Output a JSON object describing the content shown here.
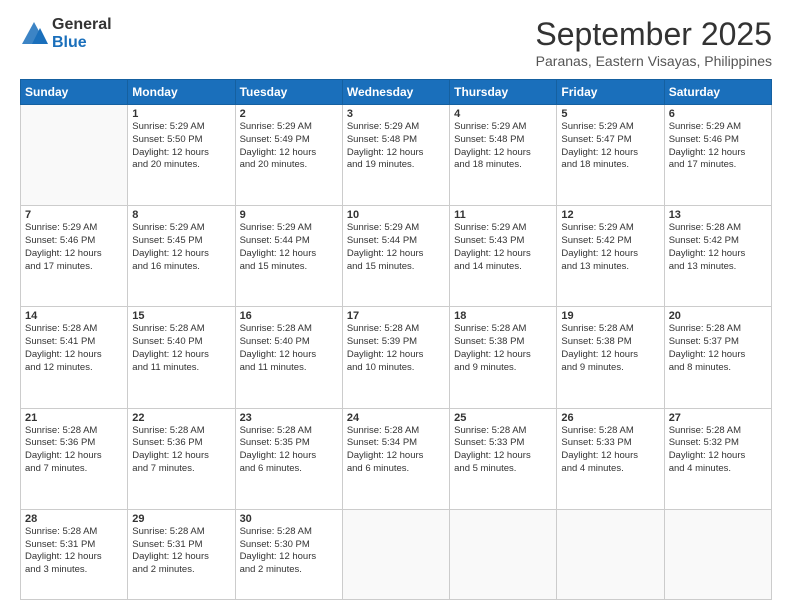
{
  "logo": {
    "general": "General",
    "blue": "Blue"
  },
  "header": {
    "month": "September 2025",
    "location": "Paranas, Eastern Visayas, Philippines"
  },
  "days_of_week": [
    "Sunday",
    "Monday",
    "Tuesday",
    "Wednesday",
    "Thursday",
    "Friday",
    "Saturday"
  ],
  "weeks": [
    [
      {
        "day": "",
        "info": ""
      },
      {
        "day": "1",
        "info": "Sunrise: 5:29 AM\nSunset: 5:50 PM\nDaylight: 12 hours\nand 20 minutes."
      },
      {
        "day": "2",
        "info": "Sunrise: 5:29 AM\nSunset: 5:49 PM\nDaylight: 12 hours\nand 20 minutes."
      },
      {
        "day": "3",
        "info": "Sunrise: 5:29 AM\nSunset: 5:48 PM\nDaylight: 12 hours\nand 19 minutes."
      },
      {
        "day": "4",
        "info": "Sunrise: 5:29 AM\nSunset: 5:48 PM\nDaylight: 12 hours\nand 18 minutes."
      },
      {
        "day": "5",
        "info": "Sunrise: 5:29 AM\nSunset: 5:47 PM\nDaylight: 12 hours\nand 18 minutes."
      },
      {
        "day": "6",
        "info": "Sunrise: 5:29 AM\nSunset: 5:46 PM\nDaylight: 12 hours\nand 17 minutes."
      }
    ],
    [
      {
        "day": "7",
        "info": "Sunrise: 5:29 AM\nSunset: 5:46 PM\nDaylight: 12 hours\nand 17 minutes."
      },
      {
        "day": "8",
        "info": "Sunrise: 5:29 AM\nSunset: 5:45 PM\nDaylight: 12 hours\nand 16 minutes."
      },
      {
        "day": "9",
        "info": "Sunrise: 5:29 AM\nSunset: 5:44 PM\nDaylight: 12 hours\nand 15 minutes."
      },
      {
        "day": "10",
        "info": "Sunrise: 5:29 AM\nSunset: 5:44 PM\nDaylight: 12 hours\nand 15 minutes."
      },
      {
        "day": "11",
        "info": "Sunrise: 5:29 AM\nSunset: 5:43 PM\nDaylight: 12 hours\nand 14 minutes."
      },
      {
        "day": "12",
        "info": "Sunrise: 5:29 AM\nSunset: 5:42 PM\nDaylight: 12 hours\nand 13 minutes."
      },
      {
        "day": "13",
        "info": "Sunrise: 5:28 AM\nSunset: 5:42 PM\nDaylight: 12 hours\nand 13 minutes."
      }
    ],
    [
      {
        "day": "14",
        "info": "Sunrise: 5:28 AM\nSunset: 5:41 PM\nDaylight: 12 hours\nand 12 minutes."
      },
      {
        "day": "15",
        "info": "Sunrise: 5:28 AM\nSunset: 5:40 PM\nDaylight: 12 hours\nand 11 minutes."
      },
      {
        "day": "16",
        "info": "Sunrise: 5:28 AM\nSunset: 5:40 PM\nDaylight: 12 hours\nand 11 minutes."
      },
      {
        "day": "17",
        "info": "Sunrise: 5:28 AM\nSunset: 5:39 PM\nDaylight: 12 hours\nand 10 minutes."
      },
      {
        "day": "18",
        "info": "Sunrise: 5:28 AM\nSunset: 5:38 PM\nDaylight: 12 hours\nand 9 minutes."
      },
      {
        "day": "19",
        "info": "Sunrise: 5:28 AM\nSunset: 5:38 PM\nDaylight: 12 hours\nand 9 minutes."
      },
      {
        "day": "20",
        "info": "Sunrise: 5:28 AM\nSunset: 5:37 PM\nDaylight: 12 hours\nand 8 minutes."
      }
    ],
    [
      {
        "day": "21",
        "info": "Sunrise: 5:28 AM\nSunset: 5:36 PM\nDaylight: 12 hours\nand 7 minutes."
      },
      {
        "day": "22",
        "info": "Sunrise: 5:28 AM\nSunset: 5:36 PM\nDaylight: 12 hours\nand 7 minutes."
      },
      {
        "day": "23",
        "info": "Sunrise: 5:28 AM\nSunset: 5:35 PM\nDaylight: 12 hours\nand 6 minutes."
      },
      {
        "day": "24",
        "info": "Sunrise: 5:28 AM\nSunset: 5:34 PM\nDaylight: 12 hours\nand 6 minutes."
      },
      {
        "day": "25",
        "info": "Sunrise: 5:28 AM\nSunset: 5:33 PM\nDaylight: 12 hours\nand 5 minutes."
      },
      {
        "day": "26",
        "info": "Sunrise: 5:28 AM\nSunset: 5:33 PM\nDaylight: 12 hours\nand 4 minutes."
      },
      {
        "day": "27",
        "info": "Sunrise: 5:28 AM\nSunset: 5:32 PM\nDaylight: 12 hours\nand 4 minutes."
      }
    ],
    [
      {
        "day": "28",
        "info": "Sunrise: 5:28 AM\nSunset: 5:31 PM\nDaylight: 12 hours\nand 3 minutes."
      },
      {
        "day": "29",
        "info": "Sunrise: 5:28 AM\nSunset: 5:31 PM\nDaylight: 12 hours\nand 2 minutes."
      },
      {
        "day": "30",
        "info": "Sunrise: 5:28 AM\nSunset: 5:30 PM\nDaylight: 12 hours\nand 2 minutes."
      },
      {
        "day": "",
        "info": ""
      },
      {
        "day": "",
        "info": ""
      },
      {
        "day": "",
        "info": ""
      },
      {
        "day": "",
        "info": ""
      }
    ]
  ]
}
